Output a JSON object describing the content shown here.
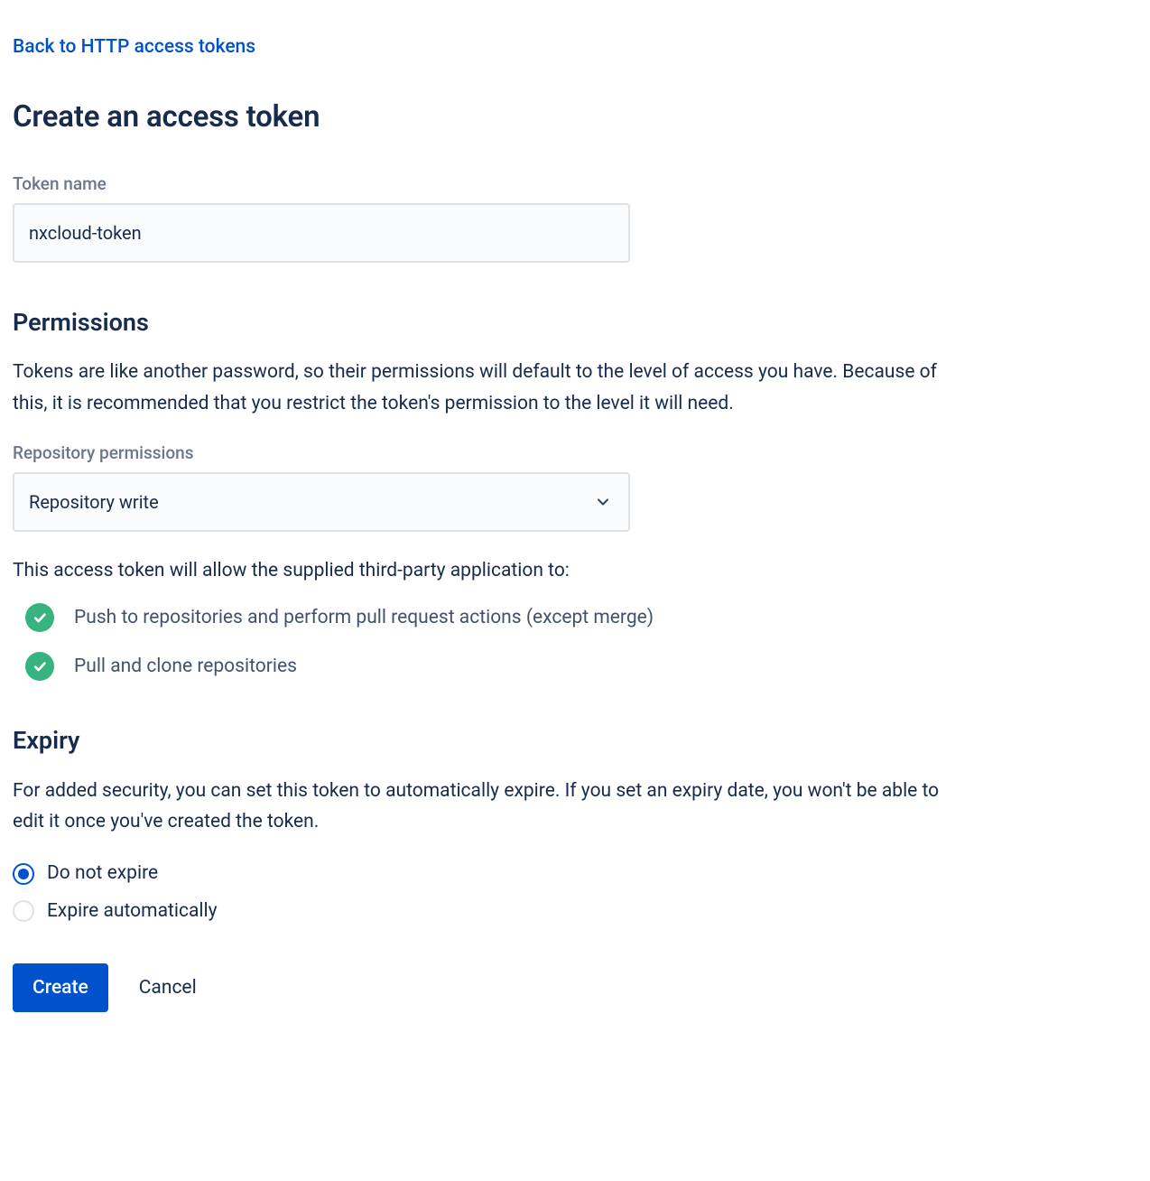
{
  "back_link": "Back to HTTP access tokens",
  "page_title": "Create an access token",
  "token_name": {
    "label": "Token name",
    "value": "nxcloud-token"
  },
  "permissions": {
    "heading": "Permissions",
    "description": "Tokens are like another password, so their permissions will default to the level of access you have. Because of this, it is recommended that you restrict the token's permission to the level it will need.",
    "repo_label": "Repository permissions",
    "repo_selected": "Repository write",
    "allow_text": "This access token will allow the supplied third-party application to:",
    "items": [
      "Push to repositories and perform pull request actions (except merge)",
      "Pull and clone repositories"
    ]
  },
  "expiry": {
    "heading": "Expiry",
    "description": "For added security, you can set this token to automatically expire. If you set an expiry date, you won't be able to edit it once you've created the token.",
    "options": [
      {
        "label": "Do not expire",
        "checked": true
      },
      {
        "label": "Expire automatically",
        "checked": false
      }
    ]
  },
  "actions": {
    "create": "Create",
    "cancel": "Cancel"
  }
}
